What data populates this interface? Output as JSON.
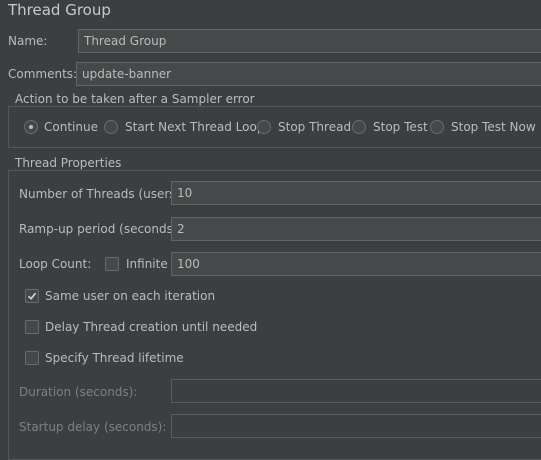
{
  "panel": {
    "title": "Thread Group",
    "name_label": "Name:",
    "name_value": "Thread Group",
    "comments_label": "Comments:",
    "comments_value": "update-banner"
  },
  "sampler_error": {
    "group_title": "Action to be taken after a Sampler error",
    "options": [
      {
        "label": "Continue",
        "selected": true
      },
      {
        "label": "Start Next Thread Loop",
        "selected": false
      },
      {
        "label": "Stop Thread",
        "selected": false
      },
      {
        "label": "Stop Test",
        "selected": false
      },
      {
        "label": "Stop Test Now",
        "selected": false
      }
    ]
  },
  "thread_properties": {
    "group_title": "Thread Properties",
    "num_threads_label": "Number of Threads (users):",
    "num_threads_value": "10",
    "rampup_label": "Ramp-up period (seconds):",
    "rampup_value": "2",
    "loop_count_label": "Loop Count:",
    "infinite_label": "Infinite",
    "infinite_checked": false,
    "loop_count_value": "100",
    "same_user_label": "Same user on each iteration",
    "same_user_checked": true,
    "delay_creation_label": "Delay Thread creation until needed",
    "delay_creation_checked": false,
    "specify_lifetime_label": "Specify Thread lifetime",
    "specify_lifetime_checked": false,
    "duration_label": "Duration (seconds):",
    "duration_value": "",
    "startup_delay_label": "Startup delay (seconds):",
    "startup_delay_value": ""
  }
}
